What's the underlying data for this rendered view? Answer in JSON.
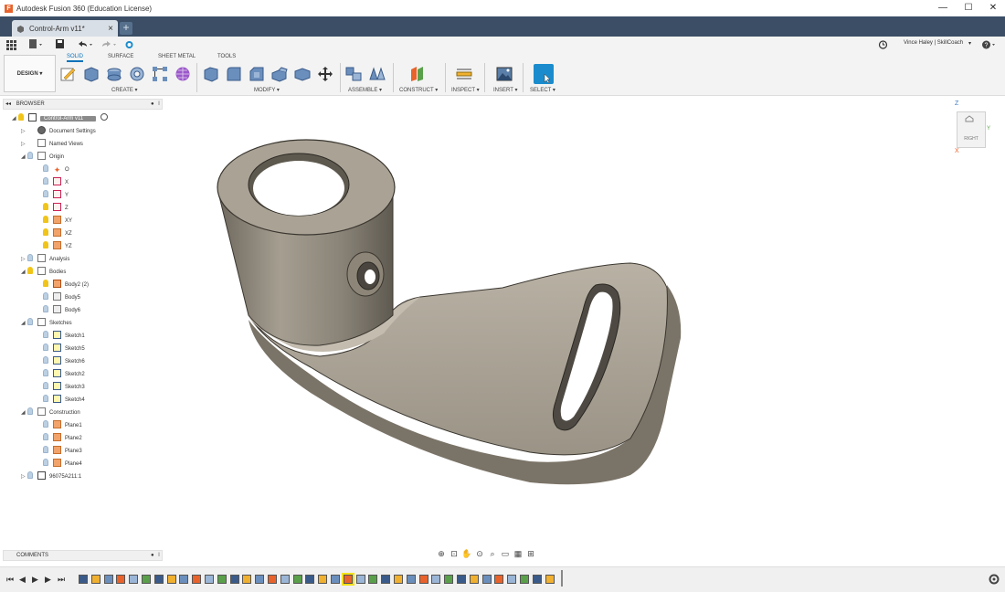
{
  "window": {
    "title": "Autodesk Fusion 360 (Education License)",
    "minimize": "—",
    "maximize": "☐",
    "close": "✕"
  },
  "doc_tab": {
    "label": "Control-Arm v11*",
    "close": "×",
    "new_tab": "+"
  },
  "user": {
    "name": "Vince Haley | SkillCoach"
  },
  "workspace": {
    "label": "DESIGN ▾"
  },
  "ribbon": {
    "tabs": [
      "SOLID",
      "SURFACE",
      "SHEET METAL",
      "TOOLS"
    ],
    "groups": [
      "CREATE ▾",
      "MODIFY ▾",
      "ASSEMBLE ▾",
      "CONSTRUCT ▾",
      "INSPECT ▾",
      "INSERT ▾",
      "SELECT ▾"
    ]
  },
  "browser": {
    "title": "BROWSER",
    "root": "Control-Arm v11",
    "items": [
      {
        "label": "Document Settings"
      },
      {
        "label": "Named Views"
      },
      {
        "label": "Origin"
      },
      {
        "label": "O"
      },
      {
        "label": "X"
      },
      {
        "label": "Y"
      },
      {
        "label": "Z"
      },
      {
        "label": "XY"
      },
      {
        "label": "XZ"
      },
      {
        "label": "YZ"
      },
      {
        "label": "Analysis"
      },
      {
        "label": "Bodies"
      },
      {
        "label": "Body2 (2)"
      },
      {
        "label": "Body5"
      },
      {
        "label": "Body6"
      },
      {
        "label": "Sketches"
      },
      {
        "label": "Sketch1"
      },
      {
        "label": "Sketch5"
      },
      {
        "label": "Sketch6"
      },
      {
        "label": "Sketch2"
      },
      {
        "label": "Sketch3"
      },
      {
        "label": "Sketch4"
      },
      {
        "label": "Construction"
      },
      {
        "label": "Plane1"
      },
      {
        "label": "Plane2"
      },
      {
        "label": "Plane3"
      },
      {
        "label": "Plane4"
      },
      {
        "label": "96075A211:1"
      }
    ]
  },
  "comments": {
    "title": "COMMENTS"
  },
  "viewcube": {
    "face": "RIGHT",
    "z": "Z",
    "x": "X",
    "y": "Y"
  },
  "colors": {
    "tabbar": "#3b4e66",
    "accent": "#0b72b8",
    "select": "#1a8ccd",
    "part": "#8d8678"
  }
}
